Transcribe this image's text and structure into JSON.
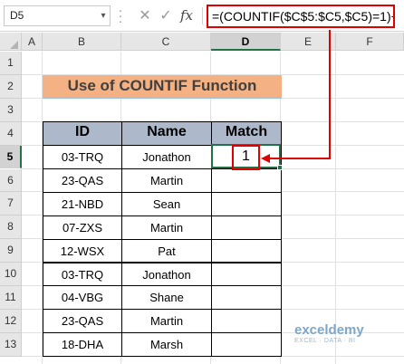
{
  "formula_bar": {
    "name_box": "D5",
    "cancel_icon": "✕",
    "enter_icon": "✓",
    "fx_label": "fx",
    "formula": "=(COUNTIF($C$5:$C5,$C5)=1)+0"
  },
  "columns": [
    "A",
    "B",
    "C",
    "D",
    "E",
    "F"
  ],
  "rows": [
    "1",
    "2",
    "3",
    "4",
    "5",
    "6",
    "7",
    "8",
    "9",
    "10",
    "11",
    "12",
    "13"
  ],
  "title": "Use of COUNTIF Function",
  "table": {
    "headers": [
      "ID",
      "Name",
      "Match"
    ],
    "rows": [
      [
        "03-TRQ",
        "Jonathon",
        "1"
      ],
      [
        "23-QAS",
        "Martin",
        ""
      ],
      [
        "21-NBD",
        "Sean",
        ""
      ],
      [
        "07-ZXS",
        "Martin",
        ""
      ],
      [
        "12-WSX",
        "Pat",
        ""
      ],
      [
        "03-TRQ",
        "Jonathon",
        ""
      ],
      [
        "04-VBG",
        "Shane",
        ""
      ],
      [
        "23-QAS",
        "Martin",
        ""
      ],
      [
        "18-DHA",
        "Marsh",
        ""
      ]
    ]
  },
  "selected": {
    "column": "D",
    "row": "5"
  },
  "watermark": {
    "brand": "exceldemy",
    "tagline": "EXCEL · DATA · BI"
  },
  "colors": {
    "title_fill": "#f4b183",
    "header_fill": "#adb9ca",
    "highlight": "#e00000",
    "selection": "#217346"
  }
}
